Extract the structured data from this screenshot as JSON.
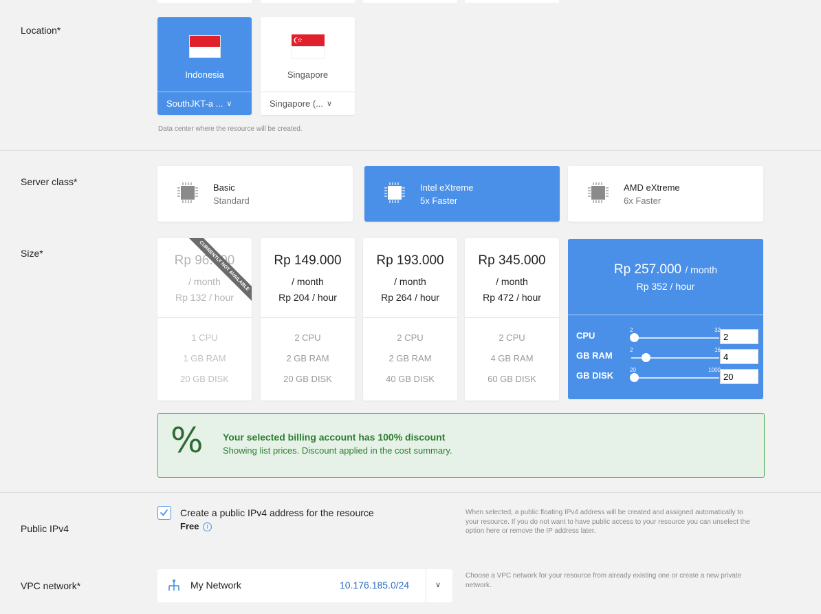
{
  "location": {
    "label": "Location*",
    "options": [
      {
        "name": "Indonesia",
        "datacenter": "SouthJKT-a ...",
        "selected": true
      },
      {
        "name": "Singapore",
        "datacenter": "Singapore (...",
        "selected": false
      }
    ],
    "hint": "Data center where the resource will be created."
  },
  "server_class": {
    "label": "Server class*",
    "options": [
      {
        "name": "Basic",
        "sub": "Standard",
        "selected": false
      },
      {
        "name": "Intel eXtreme",
        "sub": "5x Faster",
        "selected": true
      },
      {
        "name": "AMD eXtreme",
        "sub": "6x Faster",
        "selected": false
      }
    ]
  },
  "size": {
    "label": "Size*",
    "plans": [
      {
        "price": "Rp 96.000",
        "per": "/ month",
        "hourly": "Rp 132 / hour",
        "cpu": "1 CPU",
        "ram": "1 GB RAM",
        "disk": "20 GB DISK",
        "disabled": true,
        "ribbon": "CURRENTLY NOT AVAILABLE"
      },
      {
        "price": "Rp 149.000",
        "per": "/ month",
        "hourly": "Rp 204 / hour",
        "cpu": "2 CPU",
        "ram": "2 GB RAM",
        "disk": "20 GB DISK"
      },
      {
        "price": "Rp 193.000",
        "per": "/ month",
        "hourly": "Rp 264 / hour",
        "cpu": "2 CPU",
        "ram": "2 GB RAM",
        "disk": "40 GB DISK"
      },
      {
        "price": "Rp 345.000",
        "per": "/ month",
        "hourly": "Rp 472 / hour",
        "cpu": "2 CPU",
        "ram": "4 GB RAM",
        "disk": "60 GB DISK"
      }
    ],
    "custom": {
      "price": "Rp 257.000",
      "per": "/ month",
      "hourly": "Rp 352 / hour",
      "sliders": [
        {
          "label": "CPU",
          "min": "2",
          "max": "32",
          "value": "2"
        },
        {
          "label": "GB RAM",
          "min": "2",
          "max": "16",
          "value": "4"
        },
        {
          "label": "GB DISK",
          "min": "20",
          "max": "1000",
          "value": "20"
        }
      ]
    }
  },
  "discount": {
    "symbol": "%",
    "title": "Your selected billing account has 100% discount",
    "text": "Showing list prices. Discount applied in the cost summary."
  },
  "public_ipv4": {
    "label": "Public IPv4",
    "checked": true,
    "option": "Create a public IPv4 address for the resource",
    "price": "Free",
    "info_icon": "i",
    "note": "When selected, a public floating IPv4 address will be created and assigned automatically to your resource. If you do not want to have public access to your resource you can unselect the option here or remove the IP address later."
  },
  "vpc": {
    "label": "VPC network*",
    "network": "My Network",
    "cidr": "10.176.185.0/24",
    "note": "Choose a VPC network for your resource from already existing one or create a new private network."
  },
  "colors": {
    "accent": "#4a90e8",
    "success": "#2e7d33",
    "success_bg": "#e6f2e7"
  }
}
